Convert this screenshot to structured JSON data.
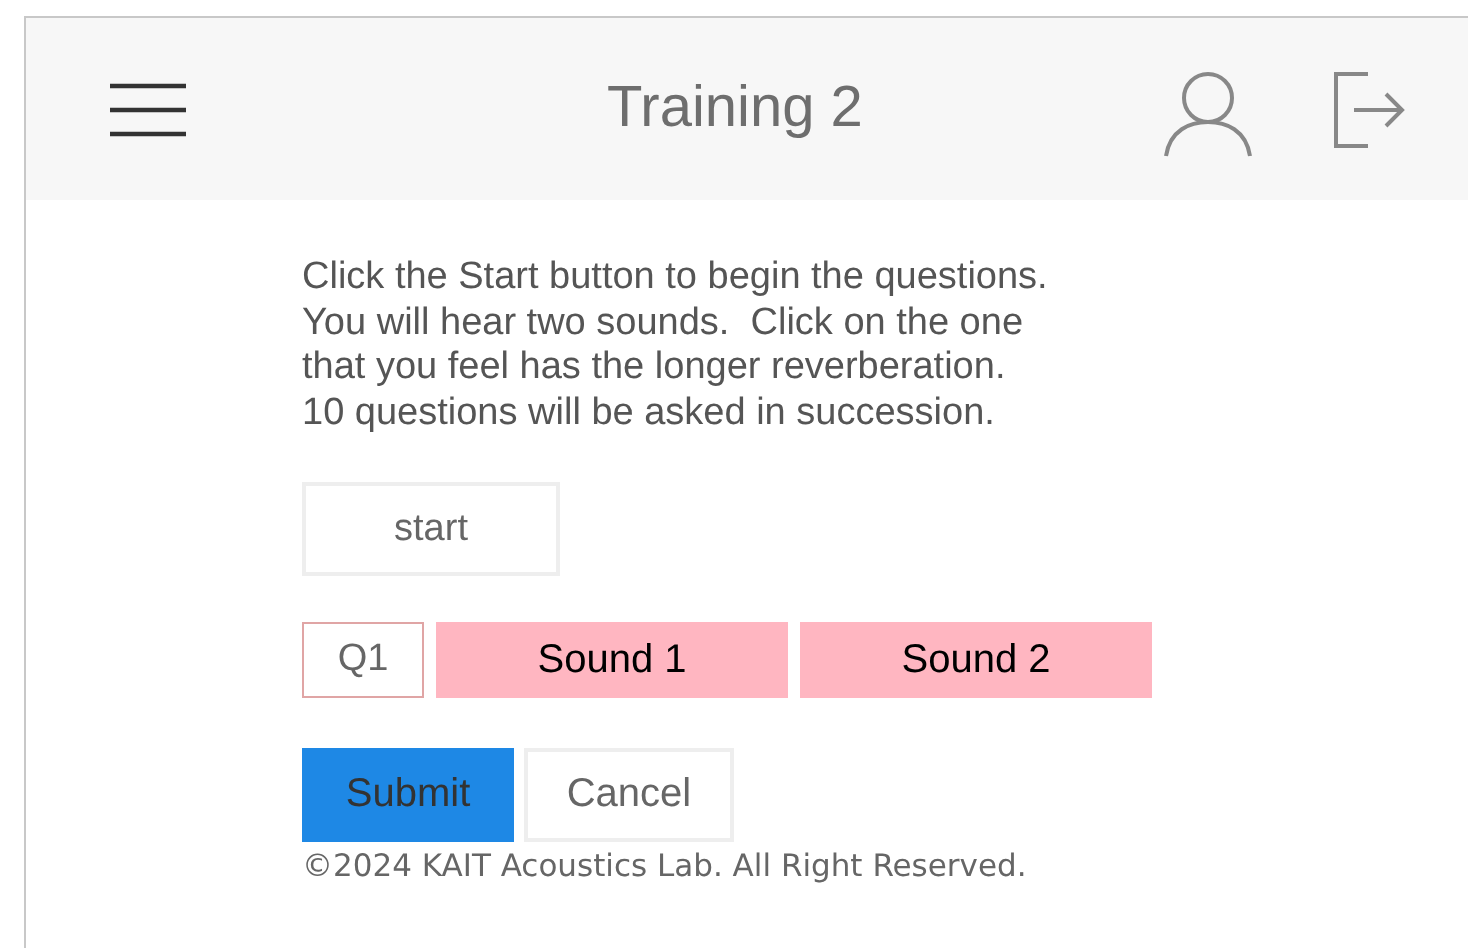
{
  "header": {
    "title": "Training 2"
  },
  "instructions": "Click the Start button to begin the questions.\nYou will hear two sounds.  Click on the one\nthat you feel has the longer reverberation.\n10 questions will be asked in succession.",
  "start_button": "start",
  "question": {
    "label": "Q1",
    "sounds": [
      "Sound 1",
      "Sound 2"
    ]
  },
  "actions": [
    {
      "label": "Submit",
      "kind": "primary"
    },
    {
      "label": "Cancel",
      "kind": "secondary"
    }
  ],
  "footer": "©2024 KAIT Acoustics Lab. All Right Reserved."
}
